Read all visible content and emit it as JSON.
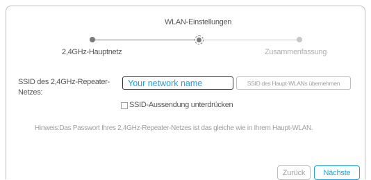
{
  "colors": {
    "accent": "#1aa3e8",
    "completed_step": "#7a7a7a",
    "pending_step": "#c8c8c8",
    "muted_text": "#9e9e9e",
    "label_text": "#555555"
  },
  "stepper": {
    "title": "WLAN-Einstellungen",
    "steps": [
      {
        "label": "2,4GHz-Hauptnetz",
        "state": "completed"
      },
      {
        "label": "",
        "state": "current"
      },
      {
        "label": "Zusammenfassung",
        "state": "pending"
      }
    ]
  },
  "form": {
    "ssid_label": "SSID des 2,4GHz-Repeater-Netzes:",
    "ssid_value": "Your network name",
    "copy_ssid_button": "SSID des Haupt-WLANs übernehmen",
    "hide_ssid_label": "SSID-Aussendung unterdrücken",
    "hide_ssid_checked": false,
    "hint": "Hinweis:Das Passwort Ihres 2,4GHz-Repeater-Netzes ist das gleiche wie in Ihrem Haupt-WLAN."
  },
  "footer": {
    "back_label": "Zurück",
    "next_label": "Nächste"
  }
}
